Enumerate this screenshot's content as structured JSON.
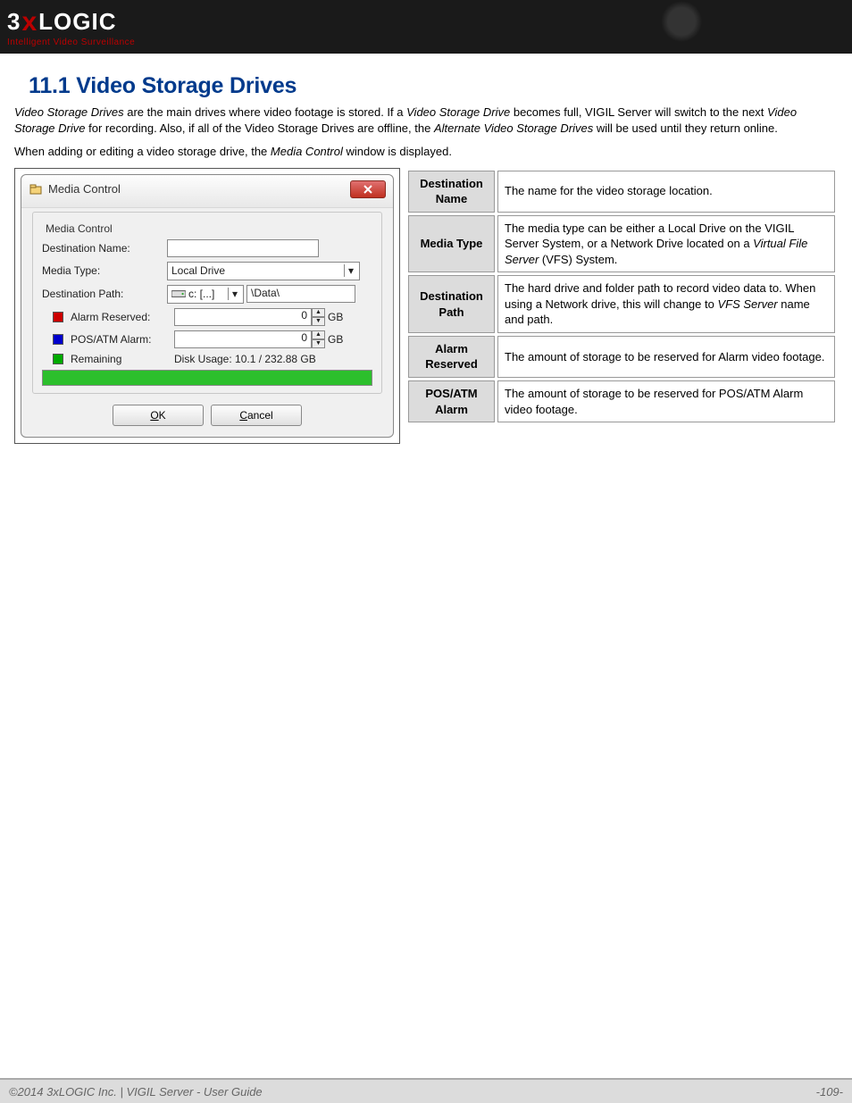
{
  "header": {
    "logo_pre": "3",
    "logo_x": "x",
    "logo_post": "LOGIC",
    "tagline": "Intelligent Video Surveillance"
  },
  "section": {
    "title": "11.1 Video Storage Drives",
    "para1_a": "Video Storage Drives",
    "para1_b": " are the main drives where video footage is stored. If a ",
    "para1_c": "Video Storage Drive",
    "para1_d": " becomes full, VIGIL Server will switch to the next ",
    "para1_e": "Video Storage Drive",
    "para1_f": " for recording. Also, if all of the Video Storage Drives are offline, the ",
    "para1_g": "Alternate Video Storage Drives",
    "para1_h": " will be used until they return online.",
    "para2_a": "When adding or editing a video storage drive, the ",
    "para2_b": "Media Control",
    "para2_c": " window is displayed."
  },
  "dialog": {
    "title": "Media Control",
    "group_label": "Media Control",
    "dest_name_label": "Destination Name:",
    "media_type_label": "Media Type:",
    "media_type_value": "Local Drive",
    "dest_path_label": "Destination Path:",
    "drive_value": "c: [...]",
    "path_value": "\\Data\\",
    "alarm_reserved_label": "Alarm Reserved:",
    "alarm_reserved_value": "0",
    "posatm_label": "POS/ATM Alarm:",
    "posatm_value": "0",
    "unit": "GB",
    "remaining_label": "Remaining",
    "disk_usage": "Disk Usage: 10.1 / 232.88 GB",
    "ok": "OK",
    "cancel": "Cancel"
  },
  "definitions": [
    {
      "k": "Destination Name",
      "v": "The name for the video storage location."
    },
    {
      "k": "Media Type",
      "v_a": "The media type can be either a Local Drive on the VIGIL Server System, or a Network Drive located on a ",
      "v_em": "Virtual File Server",
      "v_b": " (VFS) System."
    },
    {
      "k": "Destination Path",
      "v_a": "The hard drive and folder path to record video data to.  When using a Network drive, this will change to ",
      "v_em": "VFS Server",
      "v_b": " name and path."
    },
    {
      "k": "Alarm Reserved",
      "v": "The amount of storage to be reserved for Alarm video footage."
    },
    {
      "k": "POS/ATM Alarm",
      "v": "The amount of storage to be reserved for POS/ATM Alarm video footage."
    }
  ],
  "footer": {
    "left": "©2014 3xLOGIC Inc.  |  VIGIL Server - User Guide",
    "right": "-109-"
  }
}
